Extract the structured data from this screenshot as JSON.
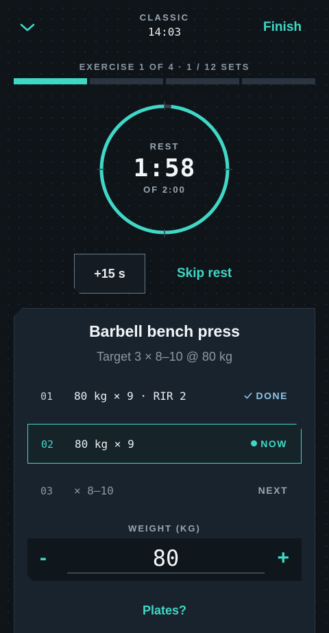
{
  "header": {
    "back_icon": "chevron-down-icon",
    "mode": "CLASSIC",
    "elapsed": "14:03",
    "finish_label": "Finish"
  },
  "progress": {
    "label": "EXERCISE 1 OF 4 · 1 / 12 SETS",
    "segments": [
      1,
      0,
      0,
      0
    ]
  },
  "rest": {
    "label": "REST",
    "remaining": "1:58",
    "total_label": "OF 2:00",
    "fraction_remaining": 0.983
  },
  "actions": {
    "add_time": "+15 s",
    "skip": "Skip rest"
  },
  "exercise": {
    "name": "Barbell bench press",
    "target": "Target 3 × 8–10 @ 80 kg",
    "sets": [
      {
        "num": "01",
        "desc": "80 kg × 9 · RIR 2",
        "status": "DONE",
        "icon": "check-icon"
      },
      {
        "num": "02",
        "desc": "80 kg × 9",
        "status": "NOW",
        "icon": "dot-icon"
      },
      {
        "num": "03",
        "desc": "× 8–10",
        "status": "NEXT"
      }
    ]
  },
  "weight": {
    "label": "WEIGHT (KG)",
    "value": "80",
    "minus": "-",
    "plus": "+"
  },
  "plates_label": "Plates?",
  "colors": {
    "accent": "#3fd8c6",
    "background": "#0f1419",
    "card": "#19232d",
    "done": "#8ec6ea"
  }
}
